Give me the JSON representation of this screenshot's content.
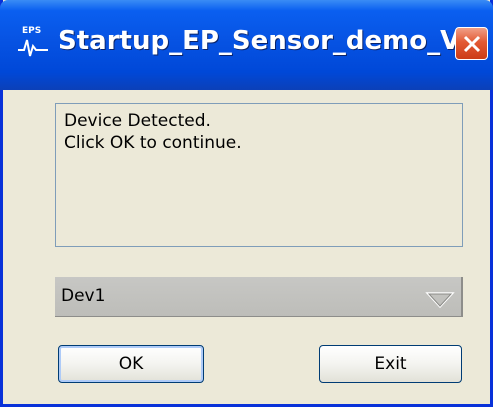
{
  "window": {
    "title": "Startup_EP_Sensor_demo_V...",
    "icon": "eps-waveform-icon",
    "icon_text": "EPS"
  },
  "message": {
    "line1": "Device Detected.",
    "line2": "Click OK to continue."
  },
  "device_select": {
    "selected": "Dev1"
  },
  "buttons": {
    "ok_label": "OK",
    "exit_label": "Exit"
  },
  "colors": {
    "titlebar": "#0753e3",
    "dialog_bg": "#ece9d8",
    "close_button": "#e35a34",
    "button_border": "#003c74"
  }
}
